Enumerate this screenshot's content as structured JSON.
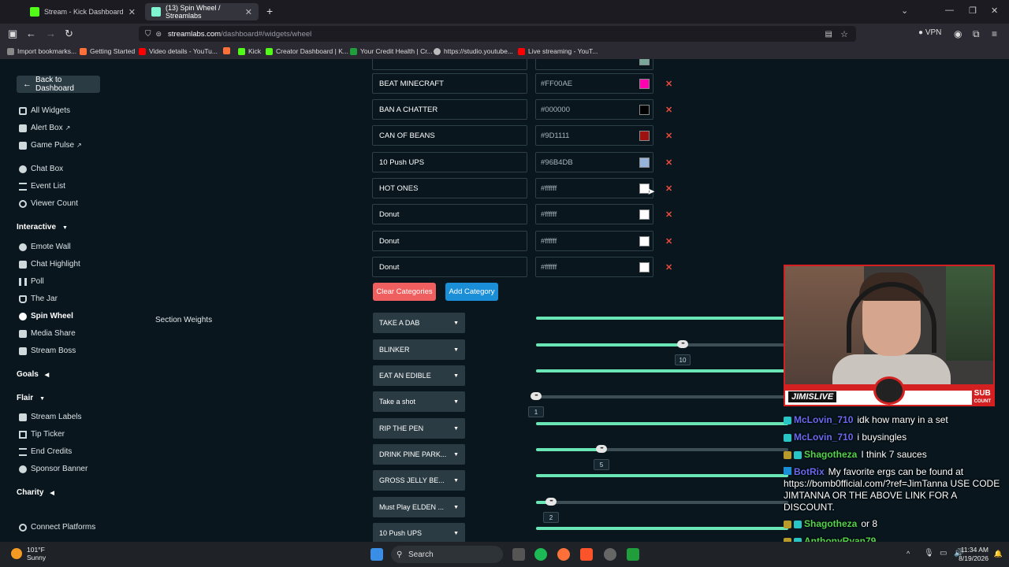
{
  "browser": {
    "tabs": [
      {
        "label": "Stream - Kick Dashboard",
        "close": "✕"
      },
      {
        "label": "(13) Spin Wheel / Streamlabs",
        "close": "✕"
      }
    ],
    "new_tab": "+",
    "url_host": "streamlabs.com",
    "url_path": "/dashboard#/widgets/wheel",
    "vpn_label": "VPN",
    "bookmarks": [
      "Import bookmarks...",
      "Getting Started",
      "Video details - YouTu...",
      "Kick",
      "Creator Dashboard | K...",
      "Your Credit Health | Cr...",
      "https://studio.youtube...",
      "Live streaming - YouT..."
    ]
  },
  "sidebar": {
    "back_label": "Back to Dashboard",
    "items_top": [
      "All Widgets",
      "Alert Box",
      "Game Pulse",
      "Chat Box",
      "Event List",
      "Viewer Count"
    ],
    "interactive_header": "Interactive",
    "interactive_items": [
      "Emote Wall",
      "Chat Highlight",
      "Poll",
      "The Jar",
      "Spin Wheel",
      "Media Share",
      "Stream Boss"
    ],
    "goals_header": "Goals",
    "flair_header": "Flair",
    "flair_items": [
      "Stream Labels",
      "Tip Ticker",
      "End Credits",
      "Sponsor Banner"
    ],
    "charity_header": "Charity",
    "connect_label": "Connect Platforms"
  },
  "categories": [
    {
      "name": "BEAT  MINECRAFT",
      "color": "#FF00AE",
      "swatch": "#FF00AE"
    },
    {
      "name": "BAN A CHATTER",
      "color": "#000000",
      "swatch": "#000000"
    },
    {
      "name": "CAN OF BEANS",
      "color": "#9D1111",
      "swatch": "#9D1111"
    },
    {
      "name": "10 Push UPS",
      "color": "#96B4DB",
      "swatch": "#96B4DB"
    },
    {
      "name": "HOT ONES",
      "color": "#ffffff",
      "swatch": "#ffffff"
    },
    {
      "name": "Donut",
      "color": "#ffffff",
      "swatch": "#ffffff"
    },
    {
      "name": "Donut",
      "color": "#ffffff",
      "swatch": "#ffffff"
    },
    {
      "name": "Donut",
      "color": "#ffffff",
      "swatch": "#ffffff"
    }
  ],
  "delete_glyph": "✕",
  "actions": {
    "clear": "Clear Categories",
    "add": "Add Category"
  },
  "section_weights_label": "Section Weights",
  "weights": [
    {
      "label": "TAKE A DAB",
      "fill": 1.0,
      "value": ""
    },
    {
      "label": "BLINKER",
      "fill": 0.58,
      "value": "10"
    },
    {
      "label": "EAT AN EDIBLE",
      "fill": 1.0,
      "value": ""
    },
    {
      "label": "Take a shot",
      "fill": 0.0,
      "value": "1"
    },
    {
      "label": "RIP THE PEN",
      "fill": 1.0,
      "value": ""
    },
    {
      "label": "DRINK PINE PARK...",
      "fill": 0.26,
      "value": "5"
    },
    {
      "label": "GROSS JELLY BE...",
      "fill": 1.0,
      "value": ""
    },
    {
      "label": "Must Play ELDEN ...",
      "fill": 0.06,
      "value": "2"
    },
    {
      "label": "10 Push UPS",
      "fill": 1.0,
      "value": ""
    }
  ],
  "stream": {
    "name_tag": "JIMISLIVE",
    "sub_label": "SUB",
    "sub_count_label": "COUNT",
    "chat": [
      {
        "user": "McLovin_710",
        "user_color": "#6a6af0",
        "text": "idk how many in a set"
      },
      {
        "user": "McLovin_710",
        "user_color": "#6a6af0",
        "text": "i buysingles"
      },
      {
        "user": "Shagotheza",
        "user_color": "#53d44a",
        "text": "I think 7 sauces"
      },
      {
        "user": "BotRix",
        "user_color": "#6a6af0",
        "text": "My favorite ergs can be found at https://bomb0fficial.com/?ref=JimTanna USE CODE JIMTANNA OR THE ABOVE LINK FOR A DISCOUNT."
      },
      {
        "user": "Shagotheza",
        "user_color": "#53d44a",
        "text": "or 8"
      },
      {
        "user": "AnthonyRyan79",
        "user_color": "#53d44a",
        "text": ""
      }
    ]
  },
  "taskbar": {
    "temp": "101°F",
    "condition": "Sunny",
    "search": "Search",
    "time": "11:34 AM",
    "date": "8/19/2026"
  }
}
